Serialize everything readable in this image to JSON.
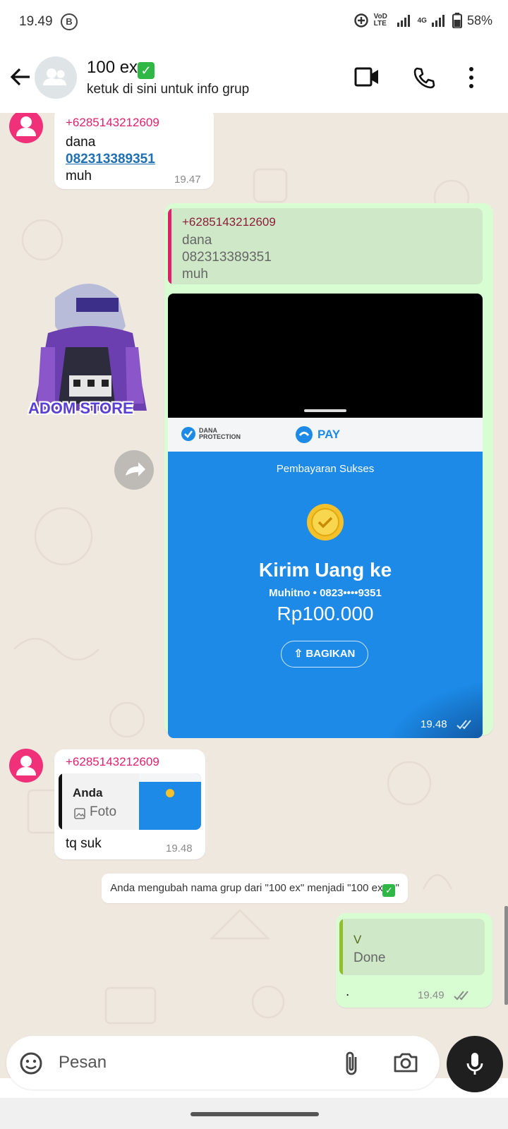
{
  "status_bar": {
    "time": "19.49",
    "b_badge": "B",
    "network_label": "VoD LTE",
    "network_gen": "4G",
    "battery": "58%"
  },
  "header": {
    "title": "100 ex",
    "title_emoji": "✅",
    "subtitle": "ketuk di sini untuk info grup"
  },
  "messages": {
    "m1": {
      "sender": "+6285143212609",
      "line1": "dana",
      "link": "082313389351",
      "line3": "muh",
      "time": "19.47"
    },
    "m2": {
      "quote_sender": "+6285143212609",
      "quote_line1": "dana",
      "quote_line2": "082313389351",
      "quote_line3": "muh",
      "time": "19.48"
    },
    "dana": {
      "protection_top": "DANA",
      "protection_bottom": "PROTECTION",
      "pay": "PAY",
      "status": "Pembayaran Sukses",
      "title": "Kirim Uang ke",
      "recipient": "Muhitno • 0823••••9351",
      "amount": "Rp100.000",
      "share": "BAGIKAN"
    },
    "sticker_text": "ADOM STORE",
    "m3": {
      "sender": "+6285143212609",
      "quote_from": "Anda",
      "quote_type": "Foto",
      "text": "tq suk",
      "time": "19.48"
    },
    "system": {
      "text": "Anda mengubah nama grup dari \"100 ex\" menjadi \"100 ex",
      "emoji": "✅",
      "end": "\""
    },
    "m4": {
      "quote_sender": "V",
      "quote_text": "Done",
      "text": ".",
      "time": "19.49"
    }
  },
  "input": {
    "placeholder": "Pesan"
  },
  "colors": {
    "chat_bg": "#efe8df",
    "out_bubble": "#d9fdd3",
    "sender_pink": "#e21f6d",
    "dana_blue": "#1c8ae6",
    "read_ticks": "#8a8a8a"
  }
}
